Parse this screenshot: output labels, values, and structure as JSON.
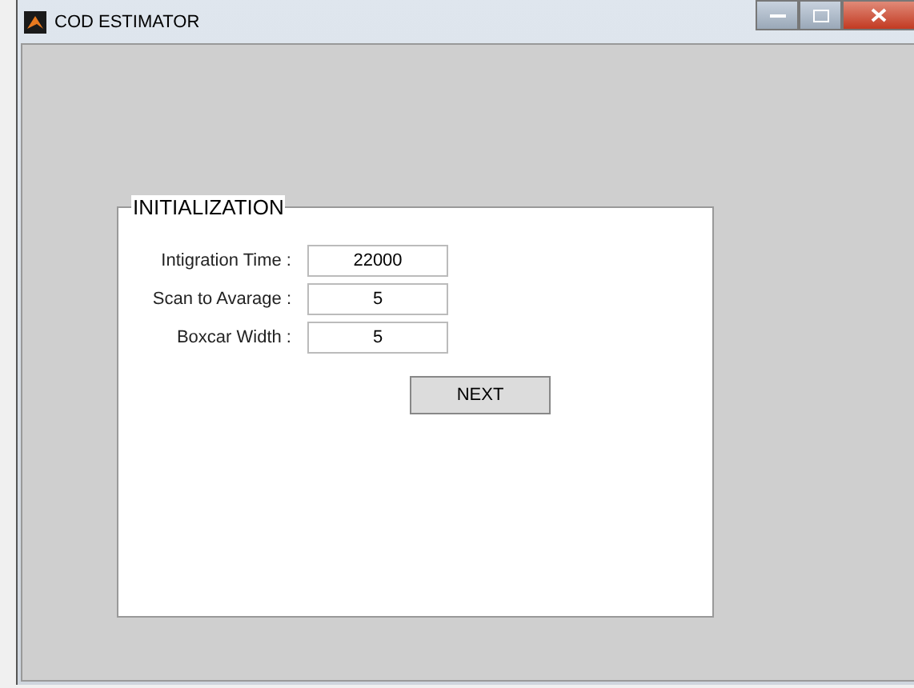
{
  "window": {
    "title": "COD ESTIMATOR"
  },
  "panel": {
    "title": "INITIALIZATION",
    "fields": [
      {
        "label": "Intigration Time :",
        "value": "22000"
      },
      {
        "label": "Scan to Avarage :",
        "value": "5"
      },
      {
        "label": "Boxcar Width :",
        "value": "5"
      }
    ],
    "button": "NEXT"
  }
}
